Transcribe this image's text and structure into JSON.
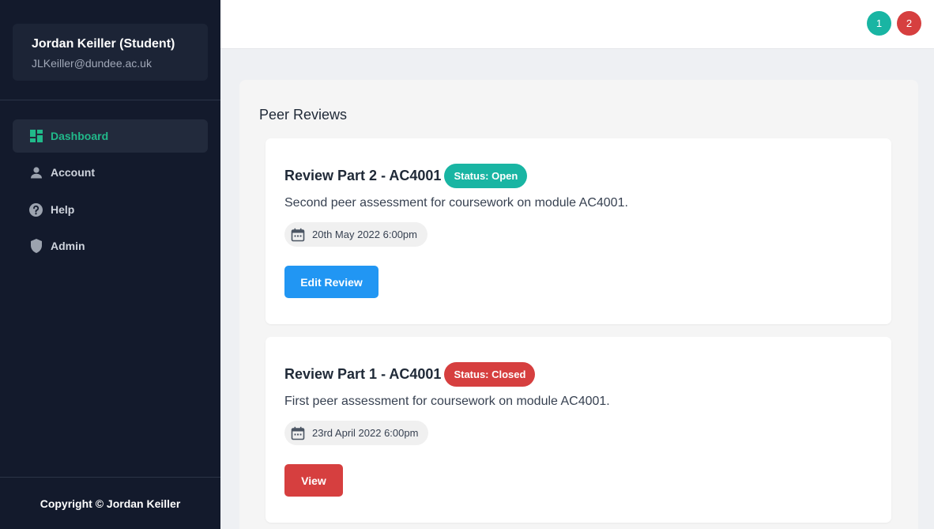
{
  "user": {
    "name": "Jordan Keiller (Student)",
    "email": "JLKeiller@dundee.ac.uk"
  },
  "nav": [
    {
      "label": "Dashboard",
      "icon": "dashboard-icon",
      "active": true
    },
    {
      "label": "Account",
      "icon": "user-icon",
      "active": false
    },
    {
      "label": "Help",
      "icon": "help-icon",
      "active": false
    },
    {
      "label": "Admin",
      "icon": "shield-icon",
      "active": false
    }
  ],
  "footer": {
    "copyright": "Copyright © Jordan Keiller"
  },
  "topbar": {
    "badge_open": "1",
    "badge_closed": "2"
  },
  "main": {
    "title": "Peer Reviews",
    "reviews": [
      {
        "title": "Review Part 2 - AC4001",
        "status": "Status: Open",
        "description": "Second peer assessment for coursework on module AC4001.",
        "date": "20th May 2022 6:00pm",
        "button": "Edit Review"
      },
      {
        "title": "Review Part 1 - AC4001",
        "status": "Status: Closed",
        "description": "First peer assessment for coursework on module AC4001.",
        "date": "23rd April 2022 6:00pm",
        "button": "View"
      }
    ]
  },
  "colors": {
    "sidebar": "#131a2c",
    "accent_green": "#21b98a",
    "teal": "#19b5a3",
    "red": "#d63f3f",
    "blue": "#2196f3"
  }
}
